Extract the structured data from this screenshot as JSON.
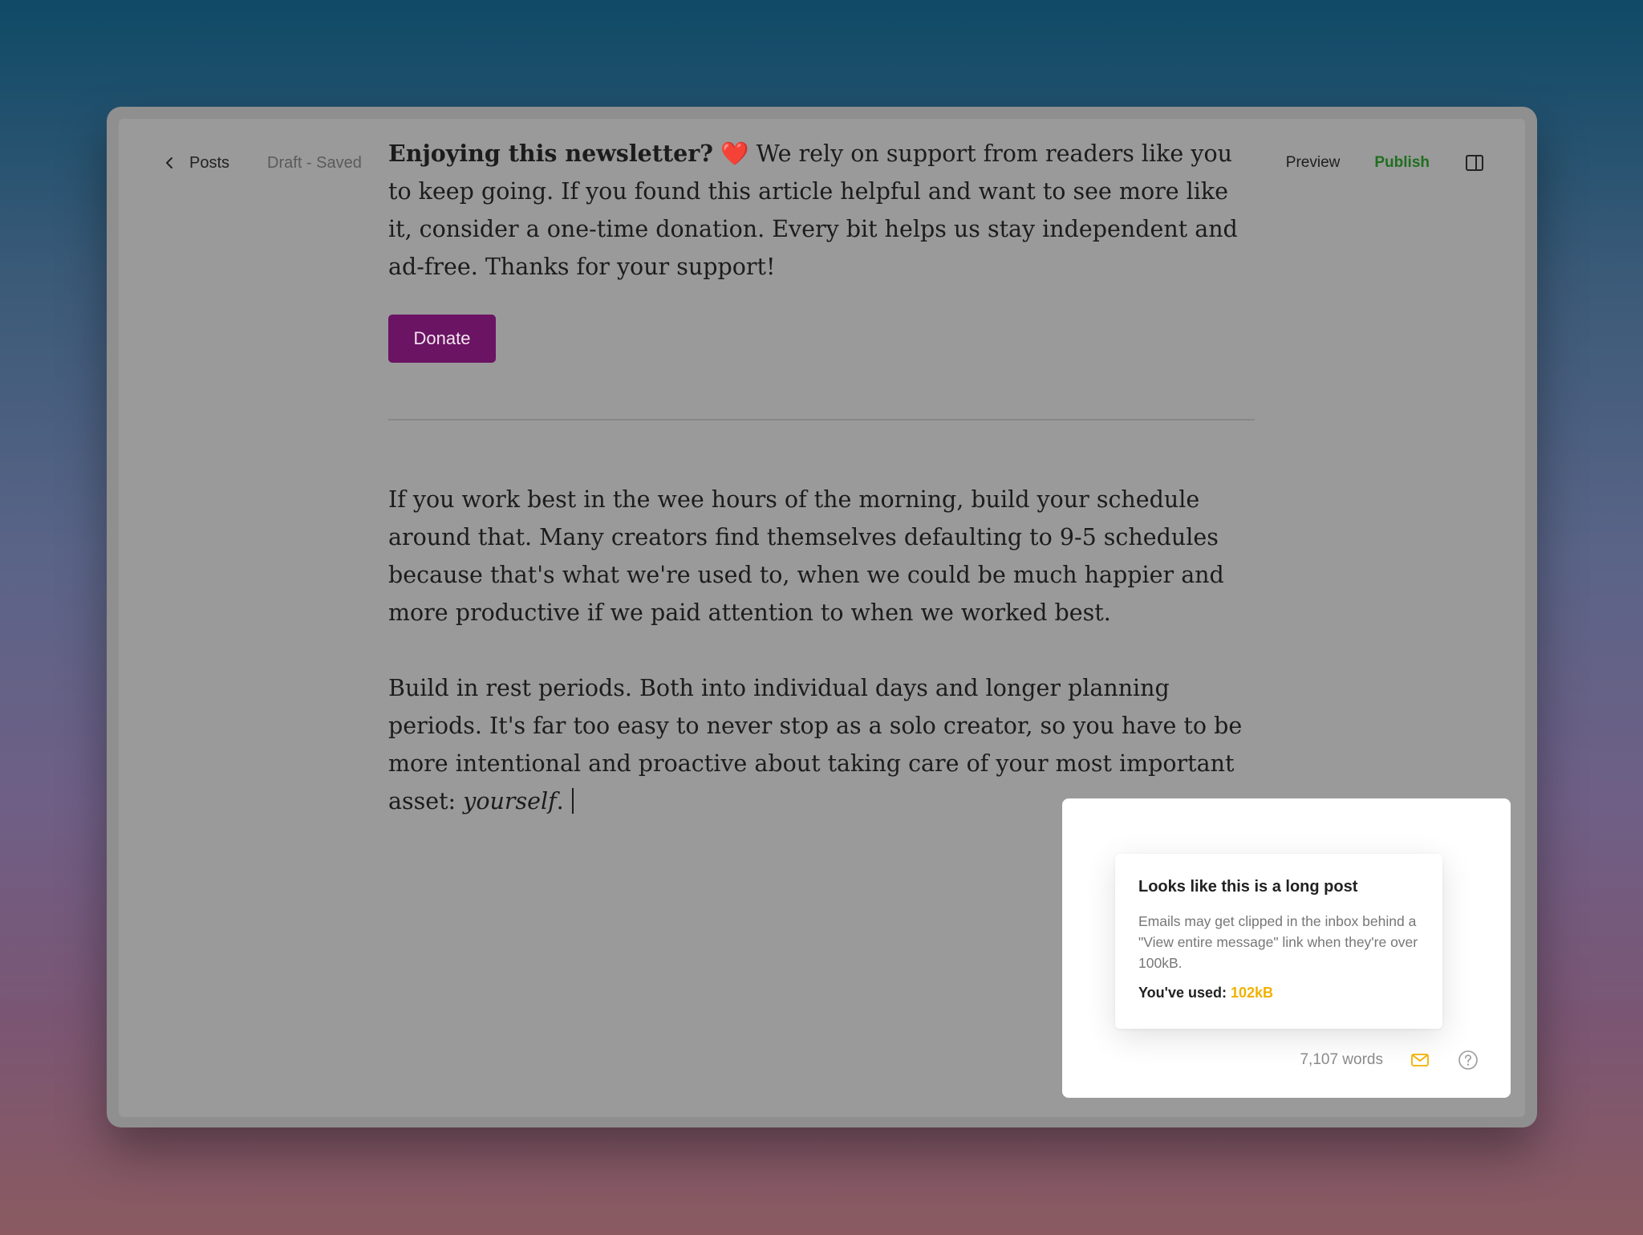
{
  "header": {
    "back_label": "Posts",
    "status": "Draft - Saved",
    "preview_label": "Preview",
    "publish_label": "Publish"
  },
  "article": {
    "cta_bold": "Enjoying this newsletter?",
    "cta_emoji": "❤️",
    "cta_text": " We rely on support from readers like you to keep going. If you found this article helpful and want to see more like it, consider a one-time donation. Every bit helps us stay independent and ad-free. Thanks for your support!",
    "donate_label": "Donate",
    "paragraph_1": "If you work best in the wee hours of the morning, build your schedule around that. Many creators find themselves defaulting to 9-5 schedules because that's what we're used to, when we could be much happier and more productive if we paid attention to when we worked best.",
    "paragraph_2_text": "Build in rest periods. Both into individual days and longer planning periods. It's far too easy to never stop as a solo creator, so you have to be more intentional and proactive about taking care of your most important asset: ",
    "paragraph_2_italic": "yourself",
    "paragraph_2_end": "."
  },
  "notice": {
    "title": "Looks like this is a long post",
    "body": "Emails may get clipped in the inbox behind a \"View entire message\" link when they're over 100kB.",
    "used_label": "You've used: ",
    "used_value": "102kB"
  },
  "footer": {
    "word_count": "7,107 words"
  },
  "colors": {
    "donate_button": "#6b1463",
    "publish": "#1f6f1f",
    "warning": "#f0b100"
  },
  "icons": {
    "back": "chevron-left-icon",
    "sidebar": "sidebar-toggle-icon",
    "email": "email-icon",
    "help": "help-circle-icon"
  }
}
